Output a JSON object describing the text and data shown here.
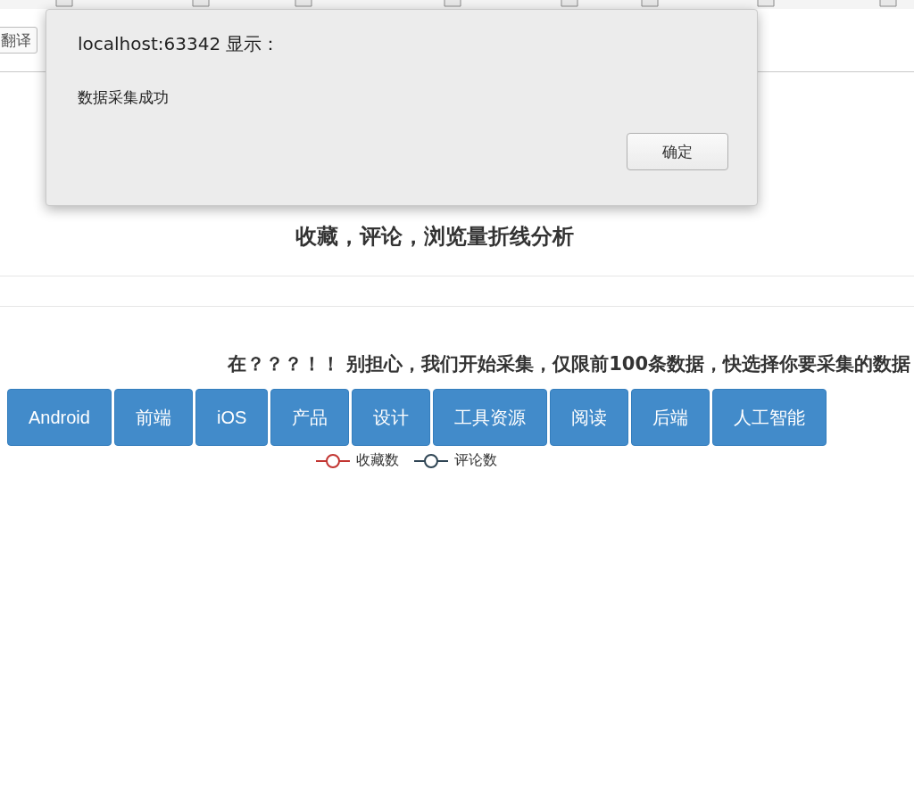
{
  "browser": {
    "translate_button": "翻译"
  },
  "page": {
    "subtitle": "收藏，评论，浏览量折线分析",
    "prompt": "在？？？！！ 别担心，我们开始采集，仅限前100条数据，快选择你要采集的数据",
    "categories": [
      {
        "label": "Android"
      },
      {
        "label": "前端"
      },
      {
        "label": "iOS"
      },
      {
        "label": "产品"
      },
      {
        "label": "设计"
      },
      {
        "label": "工具资源"
      },
      {
        "label": "阅读"
      },
      {
        "label": "后端"
      },
      {
        "label": "人工智能"
      }
    ],
    "legend": [
      {
        "label": "收藏数",
        "color": "#c23531"
      },
      {
        "label": "评论数",
        "color": "#2f4554"
      }
    ]
  },
  "dialog": {
    "title": "localhost:63342 显示：",
    "message": "数据采集成功",
    "ok_button": "确定"
  }
}
